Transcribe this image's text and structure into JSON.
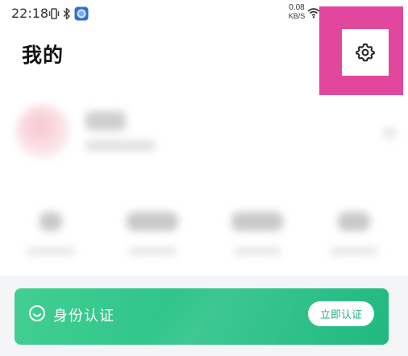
{
  "status_bar": {
    "time": "22:18",
    "net_speed_value": "0.08",
    "net_speed_unit": "KB/S",
    "icons": [
      "vibrate-icon",
      "bluetooth-icon",
      "app-notification-icon",
      "wifi-icon"
    ]
  },
  "header": {
    "title": "我的",
    "settings_icon": "gear-icon",
    "highlight_color": "#e0479d"
  },
  "identity_card": {
    "label": "身份认证",
    "button_label": "立即认证",
    "icon": "smile-face-icon",
    "color": "#30c58a"
  }
}
